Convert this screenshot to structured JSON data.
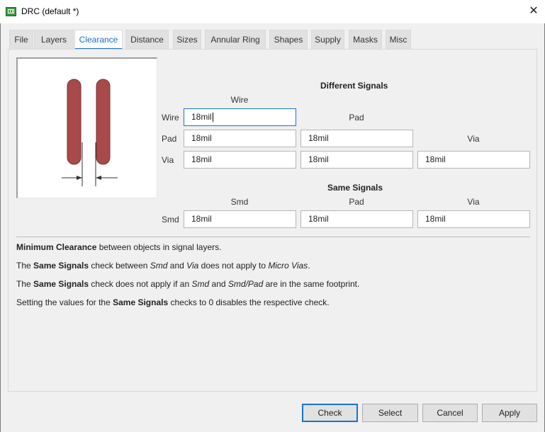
{
  "window": {
    "title": "DRC (default *)",
    "app_icon": "drc-board-icon",
    "close_icon": "close-icon"
  },
  "tabs": [
    {
      "label": "File"
    },
    {
      "label": "Layers"
    },
    {
      "label": "Clearance",
      "active": true
    },
    {
      "label": "Distance"
    },
    {
      "label": "Sizes"
    },
    {
      "label": "Annular Ring"
    },
    {
      "label": "Shapes"
    },
    {
      "label": "Supply"
    },
    {
      "label": "Masks"
    },
    {
      "label": "Misc"
    }
  ],
  "different_signals": {
    "title": "Different Signals",
    "col_wire": "Wire",
    "col_pad": "Pad",
    "col_via": "Via",
    "row_wire": "Wire",
    "row_pad": "Pad",
    "row_via": "Via",
    "wire_wire": "18mil",
    "pad_wire": "18mil",
    "pad_pad": "18mil",
    "via_wire": "18mil",
    "via_pad": "18mil",
    "via_via": "18mil"
  },
  "same_signals": {
    "title": "Same Signals",
    "col_smd": "Smd",
    "col_pad": "Pad",
    "col_via": "Via",
    "row_smd": "Smd",
    "smd_smd": "18mil",
    "smd_pad": "18mil",
    "smd_via": "18mil"
  },
  "description": {
    "line1_bold": "Minimum Clearance",
    "line1_rest": " between objects in signal layers.",
    "line2_a": "The ",
    "line2_bold": "Same Signals",
    "line2_b": " check between ",
    "line2_i1": "Smd",
    "line2_c": " and ",
    "line2_i2": "Via",
    "line2_d": " does not apply to ",
    "line2_i3": "Micro Vias",
    "line2_e": ".",
    "line3_a": "The ",
    "line3_bold": "Same Signals",
    "line3_b": " check does not apply if an ",
    "line3_i1": "Smd",
    "line3_c": " and ",
    "line3_i2": "Smd/Pad",
    "line3_d": " are in the same footprint.",
    "line4_a": "Setting the values for the ",
    "line4_bold": "Same Signals",
    "line4_b": " checks to 0 disables the respective check."
  },
  "buttons": {
    "check": "Check",
    "select": "Select",
    "cancel": "Cancel",
    "apply": "Apply"
  },
  "colors": {
    "accent": "#1a73c8",
    "trace": "#a84a4a",
    "trace_outline": "#7a2f2f"
  }
}
